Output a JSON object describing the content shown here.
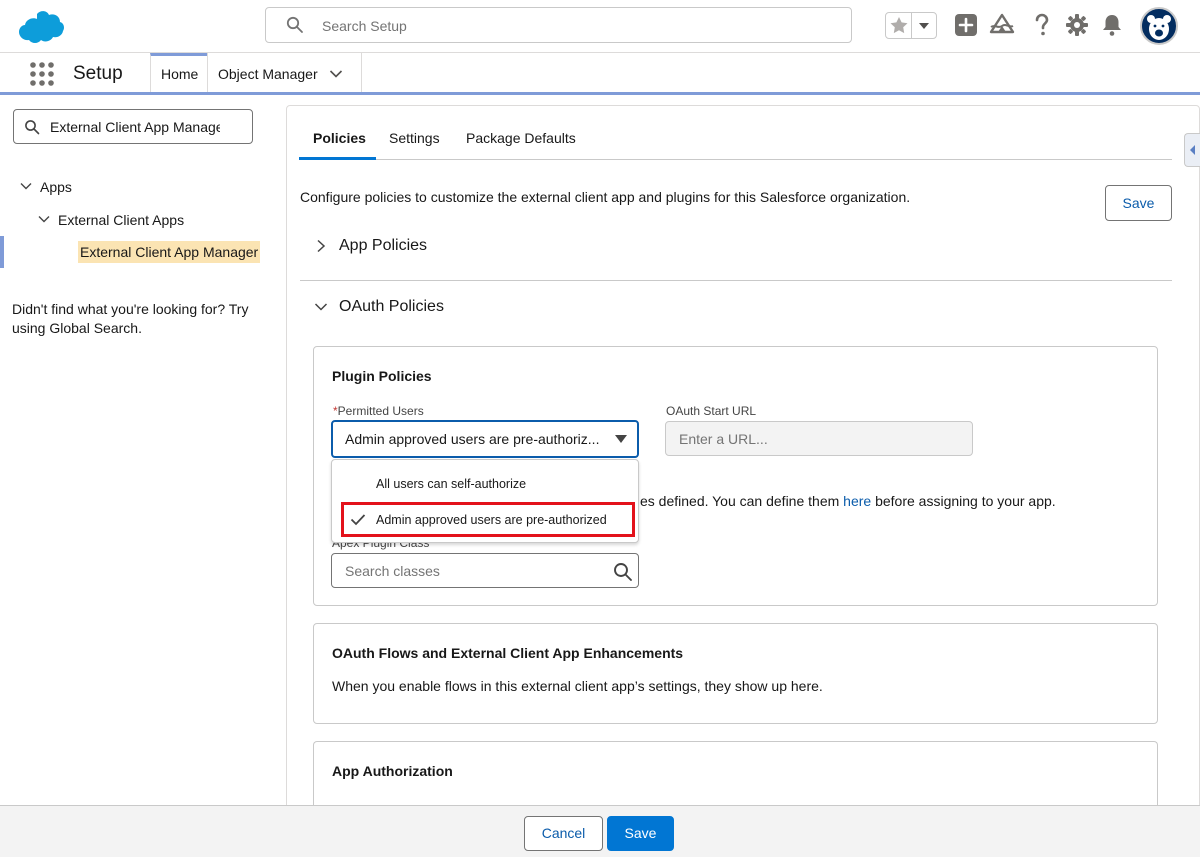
{
  "header": {
    "search_placeholder": "Search Setup",
    "icons": [
      "salesforce-cloud-logo",
      "favorites-star-icon",
      "favorites-dropdown-icon",
      "global-actions-plus-icon",
      "trailhead-icon",
      "help-icon",
      "setup-gear-icon",
      "notifications-bell-icon",
      "user-avatar"
    ]
  },
  "nav": {
    "app_title": "Setup",
    "tabs": [
      {
        "label": "Home"
      },
      {
        "label": "Object Manager"
      }
    ]
  },
  "sidebar": {
    "quickfind_value": "External Client App Managе",
    "tree": [
      {
        "label": "Apps"
      },
      {
        "label": "External Client Apps"
      },
      {
        "label": "External Client App Manager"
      }
    ],
    "not_found": "Didn't find what you're looking for? Try using Global Search."
  },
  "main": {
    "tabs": [
      {
        "label": "Policies"
      },
      {
        "label": "Settings"
      },
      {
        "label": "Package Defaults"
      }
    ],
    "description": "Configure policies to customize the external client app and plugins for this Salesforce organization.",
    "save_label": "Save",
    "sections": {
      "app_policies": "App Policies",
      "oauth_policies": "OAuth Policies"
    },
    "plugin_card": {
      "title": "Plugin Policies",
      "permitted_users_label": "Permitted Users",
      "permitted_users_value": "Admin approved users are pre-authoriz...",
      "oauth_start_url_label": "OAuth Start URL",
      "oauth_start_url_placeholder": "Enter a URL...",
      "help_text_prefix": "es defined. You can define them",
      "help_link": "here",
      "help_text_suffix": "before assigning to your app.",
      "apex_label": "Apex Plugin Class",
      "apex_placeholder": "Search classes",
      "dropdown_options": [
        {
          "label": "All users can self-authorize",
          "selected": false
        },
        {
          "label": "Admin approved users are pre-authorized",
          "selected": true
        }
      ]
    },
    "flows_card": {
      "title": "OAuth Flows and External Client App Enhancements",
      "text": "When you enable flows in this external client app’s settings, they show up here."
    },
    "auth_card": {
      "title": "App Authorization"
    }
  },
  "footer": {
    "cancel_label": "Cancel",
    "save_label": "Save"
  },
  "colors": {
    "brand_blue": "#0176d3",
    "nav_accent": "#7f9bd8",
    "highlight_red": "#e3121b",
    "selected_item_bg": "#fbe4b3"
  }
}
